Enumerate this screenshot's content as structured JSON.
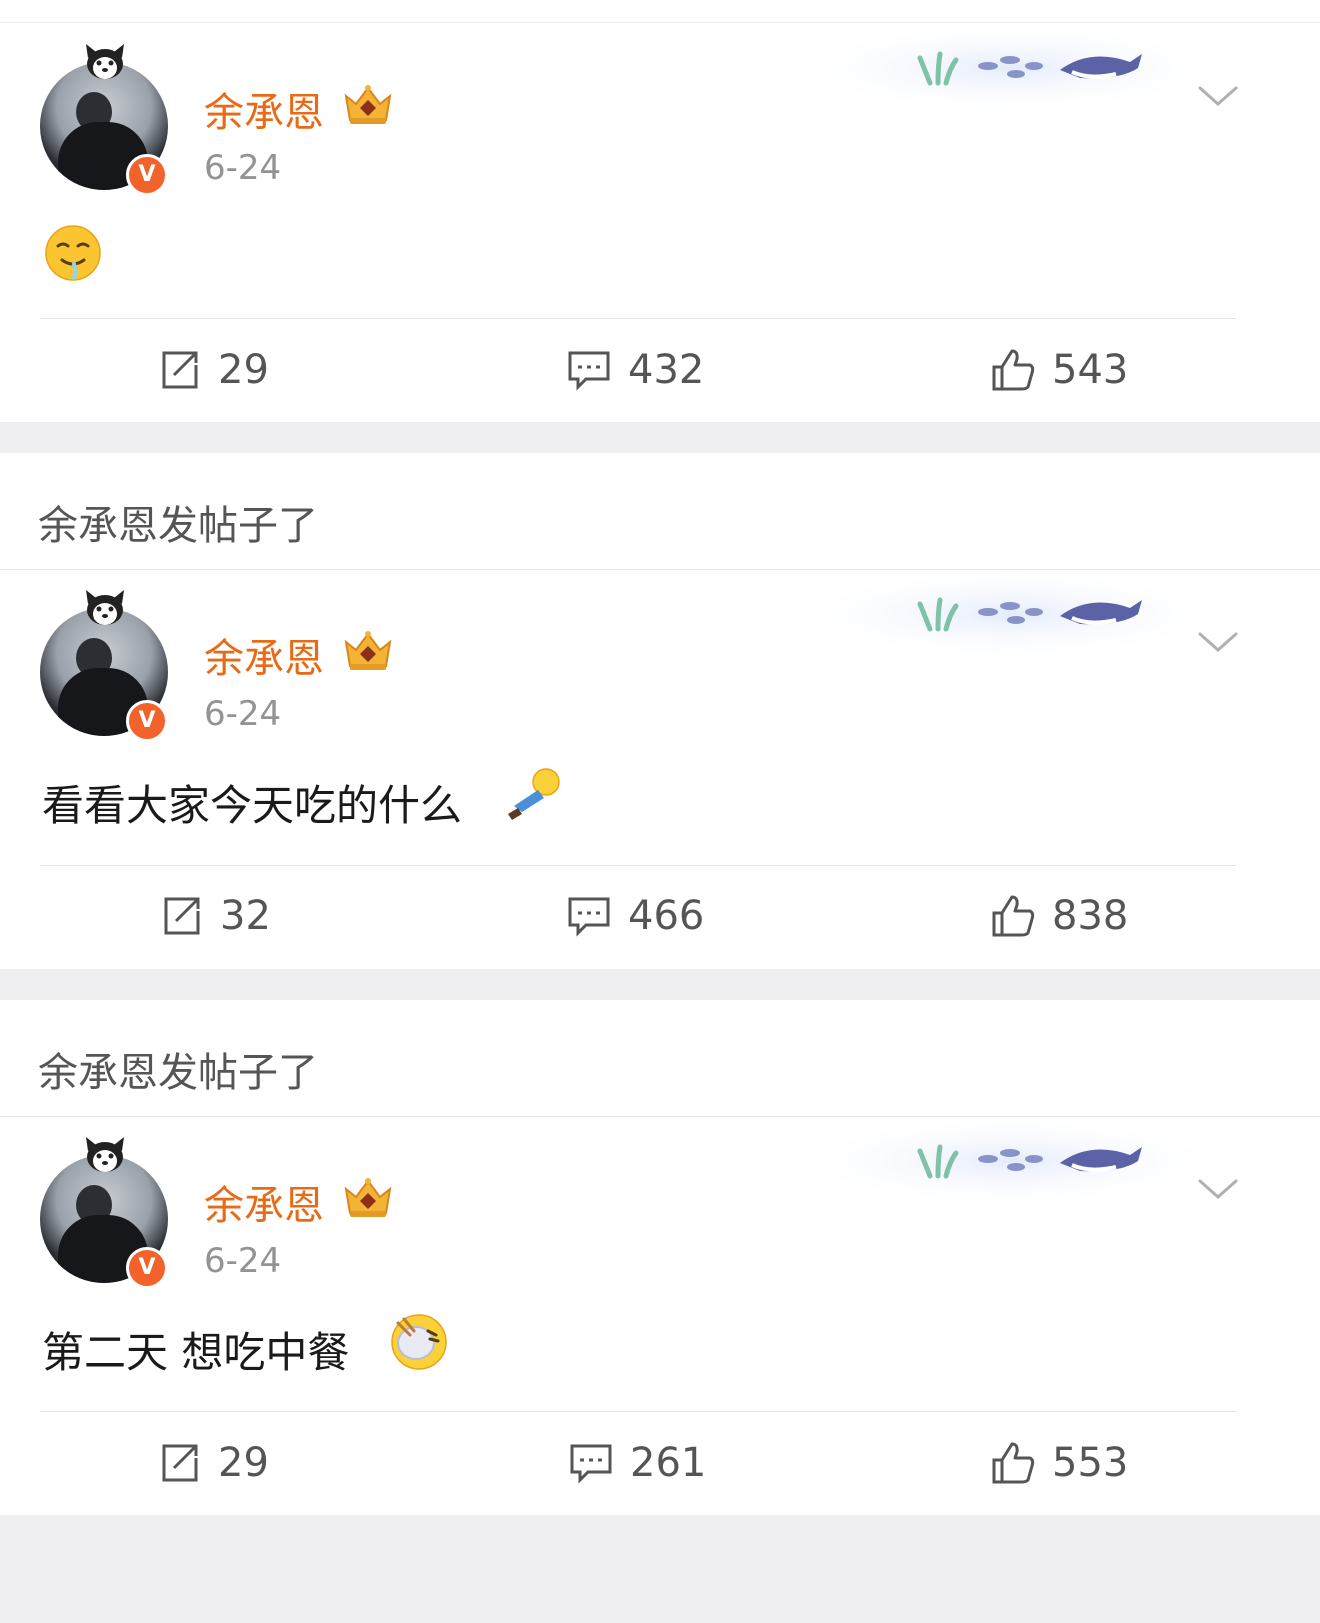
{
  "posts": [
    {
      "username": "余承恩",
      "verified_badge": "V",
      "date": "6-24",
      "text": "",
      "emoji_icon": "drooling-face-emoji",
      "repost_count": "29",
      "comment_count": "432",
      "like_count": "543"
    },
    {
      "section_header": "余承恩发帖子了",
      "username": "余承恩",
      "verified_badge": "V",
      "date": "6-24",
      "text": "看看大家今天吃的什么",
      "emoji_icon": "flying-person-emoji",
      "repost_count": "32",
      "comment_count": "466",
      "like_count": "838"
    },
    {
      "section_header": "余承恩发帖子了",
      "username": "余承恩",
      "verified_badge": "V",
      "date": "6-24",
      "text": "第二天 想吃中餐",
      "emoji_icon": "eating-face-emoji",
      "repost_count": "29",
      "comment_count": "261",
      "like_count": "553"
    }
  ],
  "colors": {
    "username": "#e86a16",
    "badge": "#f1632a",
    "page_background": "#efeff2"
  }
}
